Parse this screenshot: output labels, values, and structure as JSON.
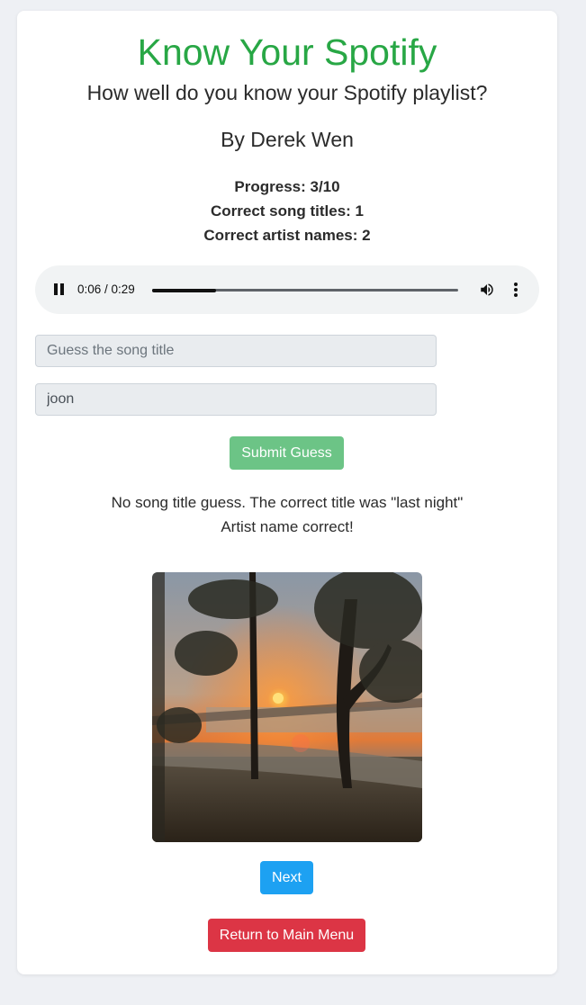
{
  "header": {
    "title": "Know Your Spotify",
    "subtitle": "How well do you know your Spotify playlist?",
    "author": "By Derek Wen"
  },
  "stats": {
    "progress": "Progress: 3/10",
    "correct_titles": "Correct song titles: 1",
    "correct_artists": "Correct artist names: 2"
  },
  "player": {
    "time": "0:06 / 0:29",
    "progress_fraction": 0.21,
    "state": "playing"
  },
  "form": {
    "title_placeholder": "Guess the song title",
    "title_value": "",
    "artist_value": "joon",
    "submit_label": "Submit Guess"
  },
  "feedback": {
    "line1": "No song title guess. The correct title was \"last night\"",
    "line2": "Artist name correct!"
  },
  "buttons": {
    "next_label": "Next",
    "menu_label": "Return to Main Menu"
  },
  "colors": {
    "title": "#28a745",
    "submit": "#6cc486",
    "next": "#1da1f2",
    "menu": "#dc3545"
  }
}
